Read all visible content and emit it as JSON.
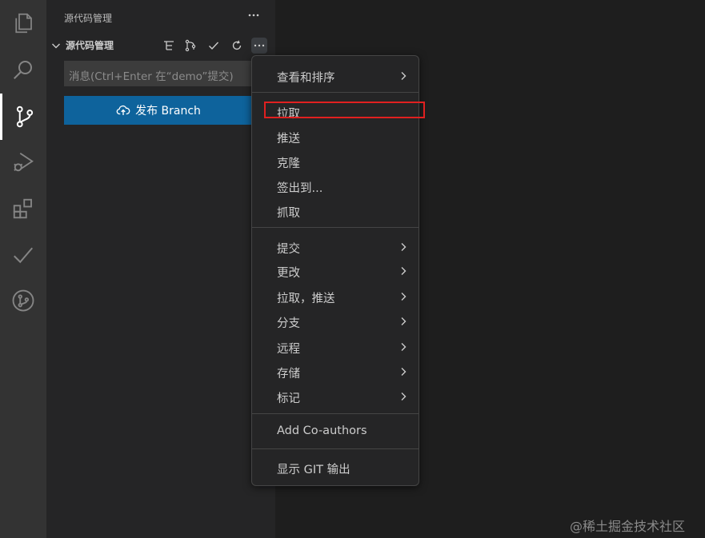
{
  "sidebar": {
    "header_title": "源代码管理",
    "section_title": "源代码管理",
    "commit_input_placeholder": "消息(Ctrl+Enter 在“demo”提交)",
    "publish_button_label": "发布 Branch"
  },
  "menu": {
    "items": [
      {
        "label": "查看和排序",
        "has_submenu": true
      },
      {
        "label": "拉取",
        "has_submenu": false,
        "highlighted": true
      },
      {
        "label": "推送",
        "has_submenu": false
      },
      {
        "label": "克隆",
        "has_submenu": false
      },
      {
        "label": "签出到...",
        "has_submenu": false
      },
      {
        "label": "抓取",
        "has_submenu": false
      },
      {
        "label": "提交",
        "has_submenu": true
      },
      {
        "label": "更改",
        "has_submenu": true
      },
      {
        "label": "拉取，推送",
        "has_submenu": true
      },
      {
        "label": "分支",
        "has_submenu": true
      },
      {
        "label": "远程",
        "has_submenu": true
      },
      {
        "label": "存储",
        "has_submenu": true
      },
      {
        "label": "标记",
        "has_submenu": true
      },
      {
        "label": "Add Co-authors",
        "has_submenu": false
      },
      {
        "label": "显示 GIT 输出",
        "has_submenu": false
      }
    ]
  },
  "activity_bar": {
    "icons": [
      "explorer-icon",
      "search-icon",
      "source-control-icon",
      "run-debug-icon",
      "extensions-icon",
      "testing-icon",
      "git-graph-icon"
    ],
    "active": "source-control-icon"
  },
  "toolbar_icons": [
    "tree-view-icon",
    "branch-compare-icon",
    "commit-check-icon",
    "refresh-icon",
    "more-actions-icon"
  ],
  "colors": {
    "accent_button": "#0e639c",
    "highlight_border": "#e02020",
    "sidebar_bg": "#252526",
    "activity_bg": "#333333",
    "editor_bg": "#1e1e1e"
  },
  "watermark": "@稀土掘金技术社区"
}
